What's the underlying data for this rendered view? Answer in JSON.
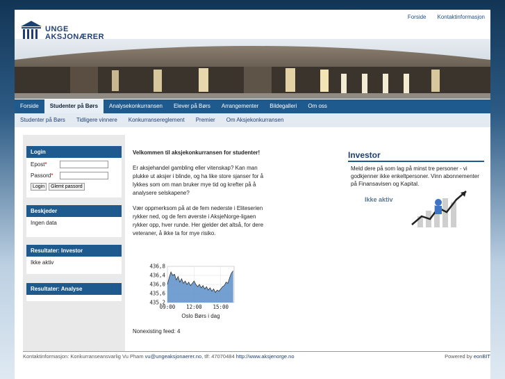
{
  "header": {
    "logo_line1": "UNGE",
    "logo_line2": "AKSJONÆRER",
    "links": [
      "Forside",
      "Kontaktinformasjon"
    ]
  },
  "nav": {
    "items": [
      "Forside",
      "Studenter på Børs",
      "Analysekonkurransen",
      "Elever på Børs",
      "Arrangementer",
      "Bildegalleri",
      "Om oss"
    ],
    "active": "Studenter på Børs"
  },
  "subnav": {
    "items": [
      "Studenter på Børs",
      "Tidligere vinnere",
      "Konkurransereglement",
      "Premier",
      "Om Aksjekonkurransen"
    ]
  },
  "login": {
    "title": "Login",
    "email_label": "Epost",
    "password_label": "Passord",
    "required_marker": "*",
    "email_value": "",
    "password_value": "",
    "login_button": "Login",
    "forgot_button": "Glemt passord"
  },
  "beskjeder": {
    "title": "Beskjeder",
    "text": "Ingen data"
  },
  "result_investor": {
    "title": "Resultater: Investor",
    "text": "Ikke aktiv"
  },
  "result_analyse": {
    "title": "Resultater: Analyse"
  },
  "main": {
    "heading": "Velkommen til aksjekonkurransen for studenter!",
    "p1": "Er aksjehandel gambling eller vitenskap? Kan man plukke ut aksjer i blinde, og ha like store sjanser for å lykkes som om man bruker mye tid og krefter på å analysere selskapene?",
    "p2": "Vær oppmerksom på at de fem nederste i Eliteserien rykker ned, og de fem øverste i AksjeNorge-ligaen rykker opp, hver runde. Her gjelder det altså, for dere veteraner, å ikke ta for mye risiko.",
    "feed": "Nonexisting feed: 4"
  },
  "chart_data": {
    "type": "area",
    "title": "",
    "xlabel": "Oslo Børs i dag",
    "ylabel": "",
    "x_ticks": [
      "09:00",
      "12:00",
      "15:00"
    ],
    "y_ticks": [
      "436,8",
      "436,4",
      "436,0",
      "435,6",
      "435,2"
    ],
    "ylim": [
      435.2,
      436.8
    ],
    "xlim": [
      9.0,
      16.5
    ],
    "series": [
      {
        "x": [
          9.0,
          9.2,
          9.4,
          9.6,
          9.8,
          10.0,
          10.2,
          10.4,
          10.6,
          10.8,
          11.0,
          11.2,
          11.4,
          11.6,
          11.8,
          12.0,
          12.2,
          12.4,
          12.6,
          12.8,
          13.0,
          13.2,
          13.4,
          13.6,
          13.8,
          14.0,
          14.2,
          14.4,
          14.6,
          14.8,
          15.0,
          15.2,
          15.4,
          15.6,
          15.8,
          16.0,
          16.2,
          16.4
        ],
        "values": [
          436.0,
          436.3,
          436.55,
          436.4,
          436.45,
          436.2,
          436.35,
          436.1,
          436.25,
          436.05,
          436.15,
          436.0,
          436.1,
          435.95,
          436.05,
          436.15,
          436.0,
          435.9,
          436.0,
          435.85,
          435.95,
          435.8,
          435.9,
          435.75,
          435.85,
          435.7,
          435.8,
          435.65,
          435.75,
          435.7,
          435.8,
          435.9,
          435.95,
          436.1,
          436.05,
          436.3,
          436.5,
          436.6
        ]
      }
    ],
    "grid": true,
    "colors": {
      "fill": "#5b8fc9",
      "line": "#333333"
    }
  },
  "investor": {
    "title": "Investor",
    "text": "Meld dere på som lag på minst tre personer - vi godkjenner ikke enkeltpersoner. Vinn abonnementer på Finansavisen og Kapital.",
    "status": "Ikke aktiv"
  },
  "footer": {
    "text": "Kontaktinformasjon: Konkurranseansvarlig Vu Pham",
    "email": "vu@ungeaksjonaerer.no",
    "phone": ", tlf: 47070484",
    "url": "http://www.aksjenorge.no",
    "powered": "Powered by",
    "powered_by": "eonBIT"
  }
}
